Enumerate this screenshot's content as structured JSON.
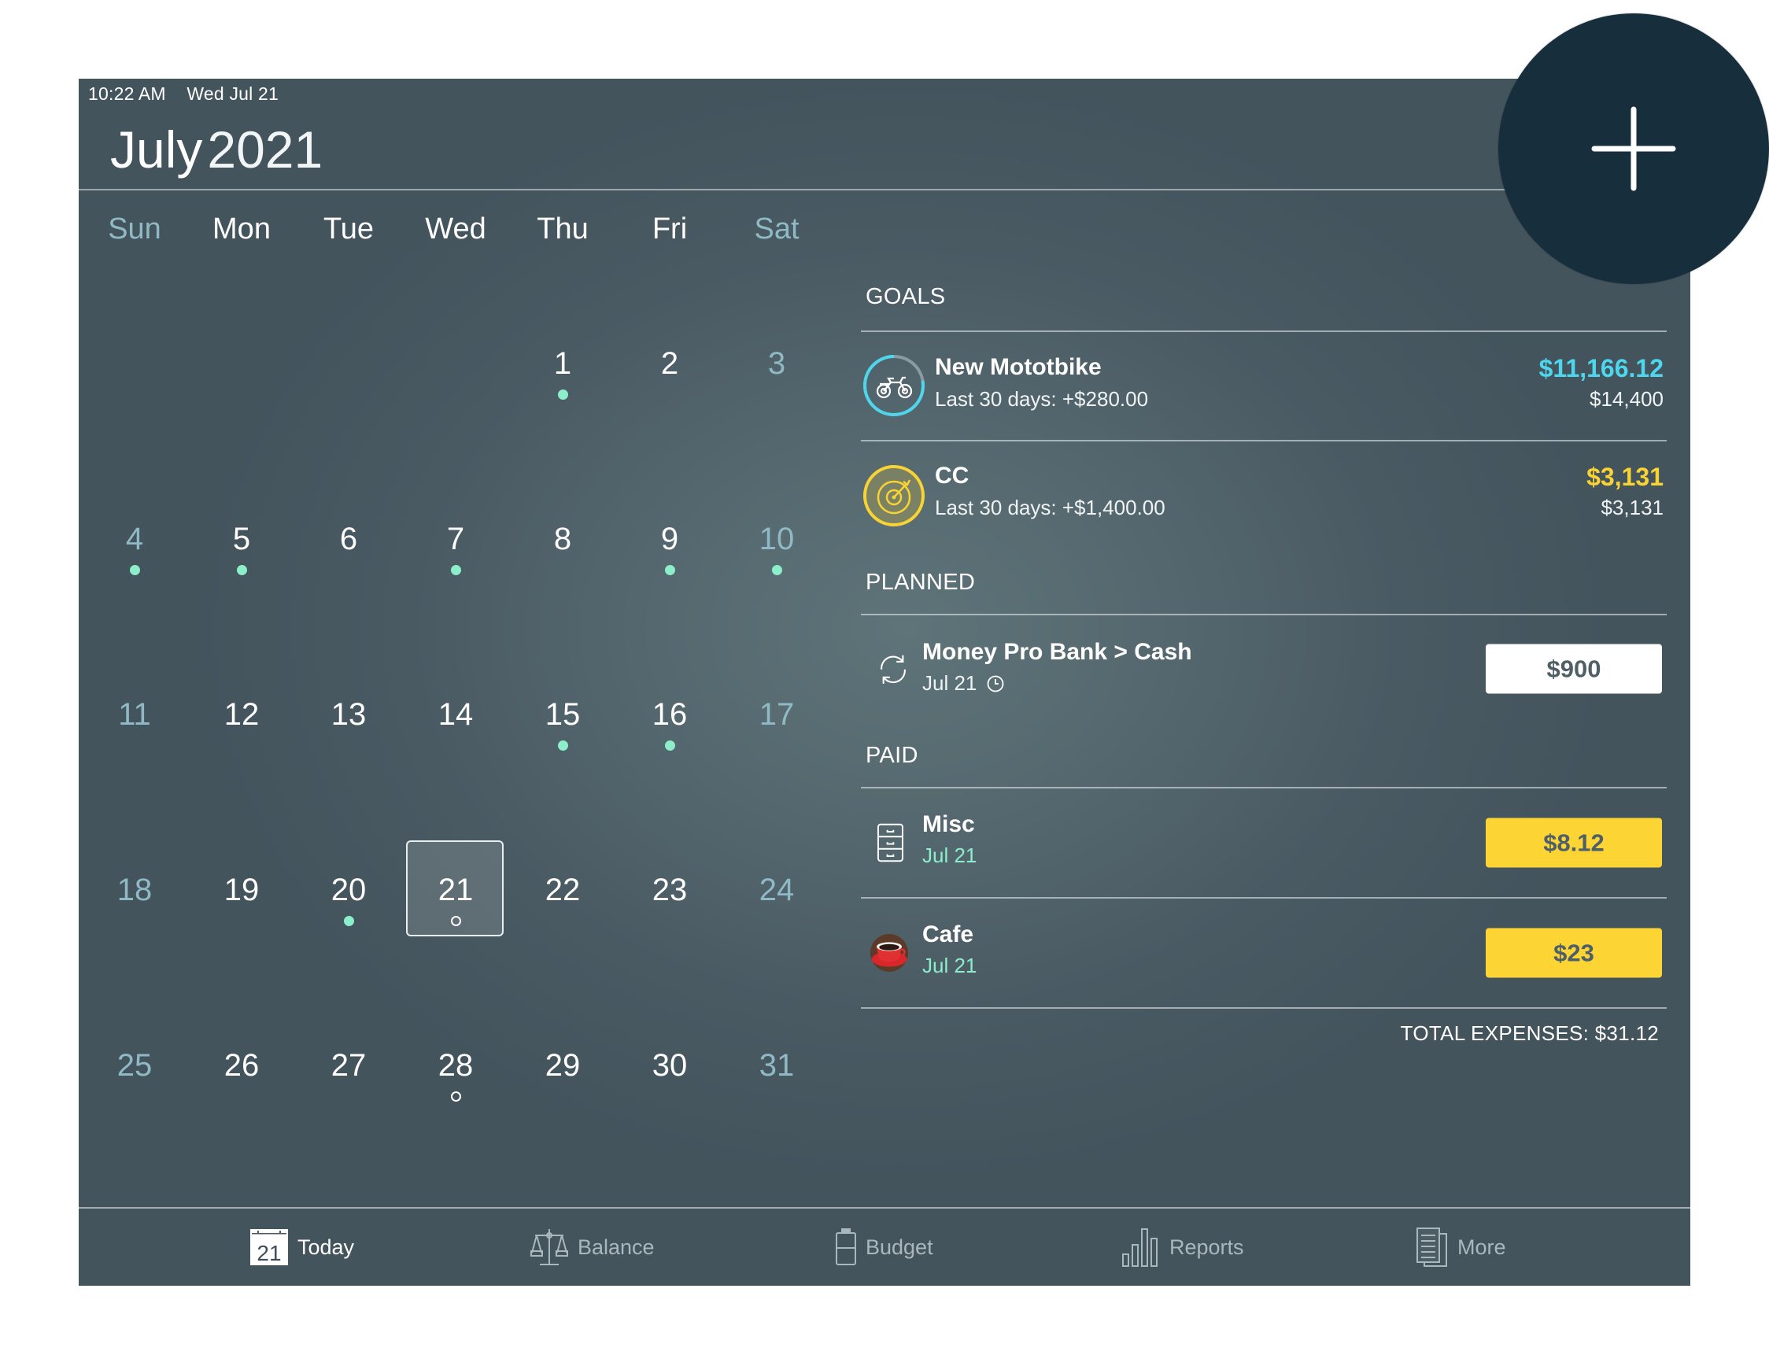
{
  "status_bar": {
    "time": "10:22 AM",
    "date": "Wed Jul 21"
  },
  "header": {
    "month": "July",
    "year": "2021"
  },
  "calendar": {
    "weekdays": [
      {
        "label": "Sun",
        "weekend": true
      },
      {
        "label": "Mon",
        "weekend": false
      },
      {
        "label": "Tue",
        "weekend": false
      },
      {
        "label": "Wed",
        "weekend": false
      },
      {
        "label": "Thu",
        "weekend": false
      },
      {
        "label": "Fri",
        "weekend": false
      },
      {
        "label": "Sat",
        "weekend": true
      }
    ],
    "today": 21,
    "dot_color": "#8ceecb",
    "weeks": [
      [
        null,
        null,
        null,
        null,
        {
          "day": "1",
          "dot": "filled"
        },
        {
          "day": "2",
          "dot": "none"
        },
        {
          "day": "3",
          "dot": "none"
        }
      ],
      [
        {
          "day": "4",
          "dot": "filled"
        },
        {
          "day": "5",
          "dot": "filled"
        },
        {
          "day": "6",
          "dot": "none"
        },
        {
          "day": "7",
          "dot": "filled"
        },
        {
          "day": "8",
          "dot": "none"
        },
        {
          "day": "9",
          "dot": "filled"
        },
        {
          "day": "10",
          "dot": "filled"
        }
      ],
      [
        {
          "day": "11",
          "dot": "none"
        },
        {
          "day": "12",
          "dot": "none"
        },
        {
          "day": "13",
          "dot": "none"
        },
        {
          "day": "14",
          "dot": "none"
        },
        {
          "day": "15",
          "dot": "filled"
        },
        {
          "day": "16",
          "dot": "filled"
        },
        {
          "day": "17",
          "dot": "none"
        }
      ],
      [
        {
          "day": "18",
          "dot": "none"
        },
        {
          "day": "19",
          "dot": "none"
        },
        {
          "day": "20",
          "dot": "filled"
        },
        {
          "day": "21",
          "dot": "open"
        },
        {
          "day": "22",
          "dot": "none"
        },
        {
          "day": "23",
          "dot": "none"
        },
        {
          "day": "24",
          "dot": "none"
        }
      ],
      [
        {
          "day": "25",
          "dot": "none"
        },
        {
          "day": "26",
          "dot": "none"
        },
        {
          "day": "27",
          "dot": "none"
        },
        {
          "day": "28",
          "dot": "open"
        },
        {
          "day": "29",
          "dot": "none"
        },
        {
          "day": "30",
          "dot": "none"
        },
        {
          "day": "31",
          "dot": "none"
        }
      ]
    ]
  },
  "goals": {
    "label": "GOALS",
    "items": [
      {
        "name": "New Mototbike",
        "sub": "Last 30 days: +$280.00",
        "amount": "$11,166.12",
        "target": "$14,400",
        "icon": "motorbike-icon",
        "color": "#4dd6ec",
        "progress": 0.775
      },
      {
        "name": "CC",
        "sub": "Last 30 days: +$1,400.00",
        "amount": "$3,131",
        "target": "$3,131",
        "icon": "target-icon",
        "color": "#f9d334",
        "progress": 1.0
      }
    ]
  },
  "planned": {
    "label": "PLANNED",
    "items": [
      {
        "name": "Money Pro Bank > Cash",
        "date": "Jul 21",
        "amount": "$900",
        "icon": "transfer-icon"
      }
    ]
  },
  "paid": {
    "label": "PAID",
    "items": [
      {
        "name": "Misc",
        "date": "Jul 21",
        "amount": "$8.12",
        "icon": "cabinet-icon"
      },
      {
        "name": "Cafe",
        "date": "Jul 21",
        "amount": "$23",
        "icon": "coffee-cup-icon"
      }
    ],
    "total": "TOTAL EXPENSES: $31.12"
  },
  "tabs": [
    {
      "label": "Today",
      "icon": "calendar-icon",
      "icon_text": "21",
      "active": true
    },
    {
      "label": "Balance",
      "icon": "scales-icon",
      "active": false
    },
    {
      "label": "Budget",
      "icon": "battery-icon",
      "active": false
    },
    {
      "label": "Reports",
      "icon": "bar-chart-icon",
      "active": false
    },
    {
      "label": "More",
      "icon": "documents-icon",
      "active": false
    }
  ],
  "fab": {
    "icon": "plus-icon"
  },
  "colors": {
    "goal_blue": "#4dd6ec",
    "goal_yellow": "#f9d334",
    "paid_pill": "#fcd535",
    "fab": "#172e3d",
    "weekend": "#8fbac5"
  }
}
